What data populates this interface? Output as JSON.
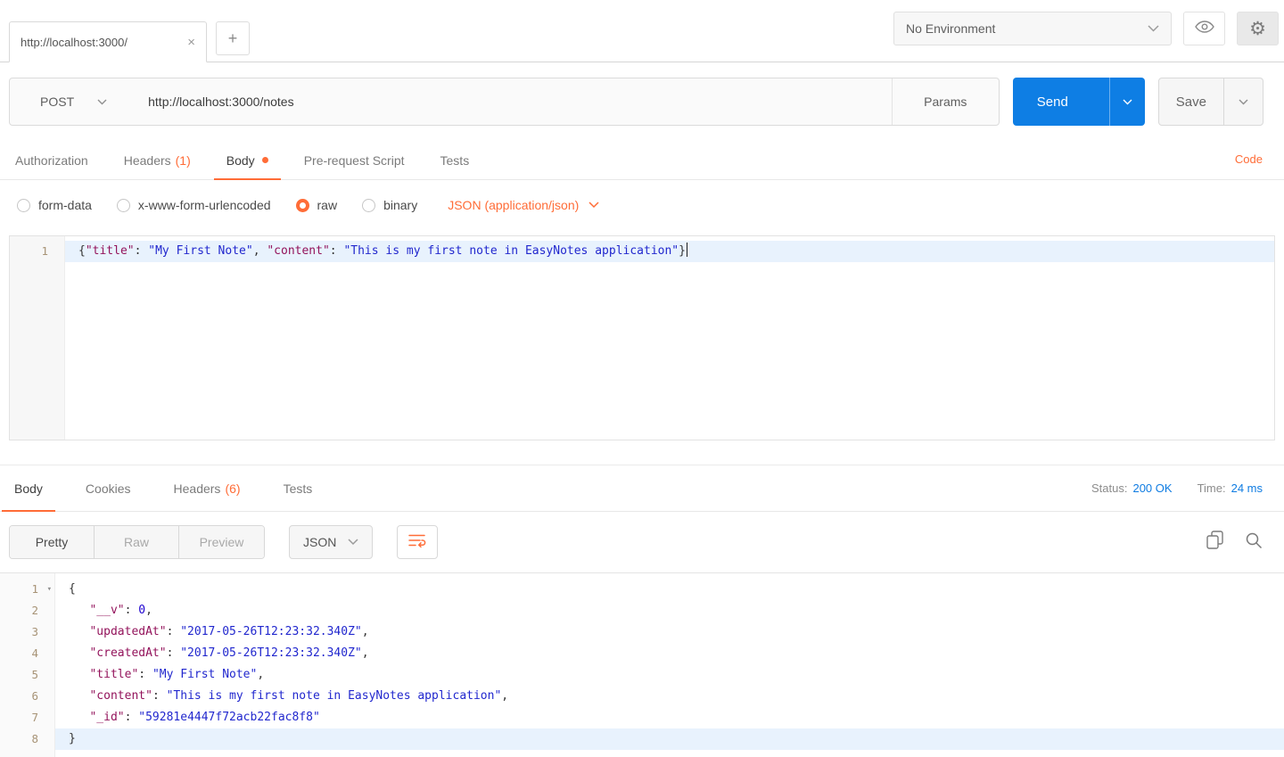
{
  "colors": {
    "accent": "#FF6C37",
    "send_button": "#0E7EE4",
    "link_blue": "#0F7CE2",
    "active_line": "#E8F2FD",
    "code_key": "#93135B",
    "code_string": "#2127CE",
    "code_number": "#1C00CF"
  },
  "topbar": {
    "tab_title": "http://localhost:3000/",
    "close": "×",
    "new_tab": "+",
    "environment_selected": "No Environment"
  },
  "request": {
    "method": "POST",
    "url": "http://localhost:3000/notes",
    "params": "Params",
    "send": "Send",
    "save": "Save"
  },
  "request_tabs": {
    "items": [
      {
        "label": "Authorization"
      },
      {
        "label": "Headers",
        "count": "(1)"
      },
      {
        "label": "Body",
        "active": true
      },
      {
        "label": "Pre-request Script"
      },
      {
        "label": "Tests"
      }
    ],
    "code": "Code"
  },
  "body_mode": {
    "options": [
      {
        "label": "form-data",
        "selected": false
      },
      {
        "label": "x-www-form-urlencoded",
        "selected": false
      },
      {
        "label": "raw",
        "selected": true
      },
      {
        "label": "binary",
        "selected": false
      }
    ],
    "content_type": "JSON (application/json)"
  },
  "request_editor": {
    "lines": [
      {
        "num": "1",
        "active": true,
        "cursor": true,
        "tokens": [
          [
            "p",
            "{"
          ],
          [
            "k",
            "\"title\""
          ],
          [
            "p",
            ": "
          ],
          [
            "s",
            "\"My First Note\""
          ],
          [
            "p",
            ", "
          ],
          [
            "k",
            "\"content\""
          ],
          [
            "p",
            ": "
          ],
          [
            "s",
            "\"This is my first note in EasyNotes application\""
          ],
          [
            "p",
            "}"
          ]
        ]
      }
    ]
  },
  "response_tabs": {
    "items": [
      {
        "label": "Body",
        "active": true
      },
      {
        "label": "Cookies"
      },
      {
        "label": "Headers",
        "count": "(6)"
      },
      {
        "label": "Tests"
      }
    ],
    "status_label": "Status:",
    "status_value": "200 OK",
    "time_label": "Time:",
    "time_value": "24 ms"
  },
  "response_toolbar": {
    "views": [
      {
        "label": "Pretty",
        "active": true
      },
      {
        "label": "Raw",
        "active": false
      },
      {
        "label": "Preview",
        "active": false
      }
    ],
    "format": "JSON"
  },
  "response_editor": {
    "lines": [
      {
        "num": "1",
        "fold": "▾",
        "tokens": [
          [
            "p",
            "{"
          ]
        ]
      },
      {
        "num": "2",
        "tokens": [
          [
            "p",
            "   "
          ],
          [
            "k",
            "\"__v\""
          ],
          [
            "p",
            ": "
          ],
          [
            "n",
            "0"
          ],
          [
            "p",
            ","
          ]
        ]
      },
      {
        "num": "3",
        "tokens": [
          [
            "p",
            "   "
          ],
          [
            "k",
            "\"updatedAt\""
          ],
          [
            "p",
            ": "
          ],
          [
            "s",
            "\"2017-05-26T12:23:32.340Z\""
          ],
          [
            "p",
            ","
          ]
        ]
      },
      {
        "num": "4",
        "tokens": [
          [
            "p",
            "   "
          ],
          [
            "k",
            "\"createdAt\""
          ],
          [
            "p",
            ": "
          ],
          [
            "s",
            "\"2017-05-26T12:23:32.340Z\""
          ],
          [
            "p",
            ","
          ]
        ]
      },
      {
        "num": "5",
        "tokens": [
          [
            "p",
            "   "
          ],
          [
            "k",
            "\"title\""
          ],
          [
            "p",
            ": "
          ],
          [
            "s",
            "\"My First Note\""
          ],
          [
            "p",
            ","
          ]
        ]
      },
      {
        "num": "6",
        "tokens": [
          [
            "p",
            "   "
          ],
          [
            "k",
            "\"content\""
          ],
          [
            "p",
            ": "
          ],
          [
            "s",
            "\"This is my first note in EasyNotes application\""
          ],
          [
            "p",
            ","
          ]
        ]
      },
      {
        "num": "7",
        "tokens": [
          [
            "p",
            "   "
          ],
          [
            "k",
            "\"_id\""
          ],
          [
            "p",
            ": "
          ],
          [
            "s",
            "\"59281e4447f72acb22fac8f8\""
          ]
        ]
      },
      {
        "num": "8",
        "active": true,
        "tokens": [
          [
            "p",
            "}"
          ]
        ]
      }
    ]
  }
}
